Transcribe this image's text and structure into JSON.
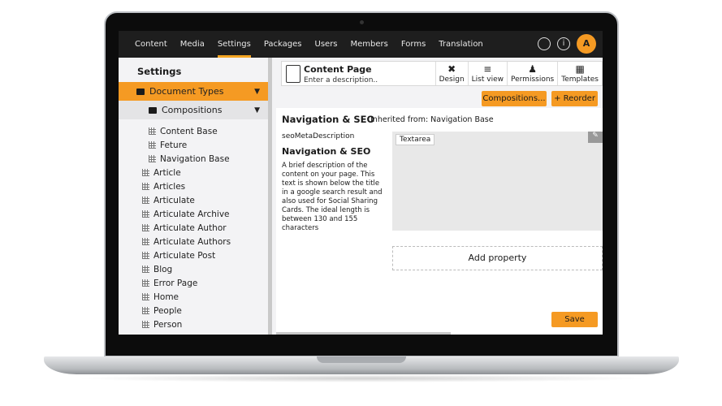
{
  "topnav": {
    "items": [
      "Content",
      "Media",
      "Settings",
      "Packages",
      "Users",
      "Members",
      "Forms",
      "Translation"
    ],
    "active": "Settings",
    "avatar": "A"
  },
  "sidebar": {
    "title": "Settings",
    "document_types": "Document Types",
    "compositions": "Compositions",
    "composition_items": [
      "Content Base",
      "Feture",
      "Navigation Base"
    ],
    "items": [
      "Article",
      "Articles",
      "Articulate",
      "Articulate Archive",
      "Articulate Author",
      "Articulate Authors",
      "Articulate Post",
      "Blog",
      "Error Page",
      "Home",
      "People",
      "Person"
    ]
  },
  "header": {
    "name": "Content Page",
    "description": "Enter a description..",
    "tools": [
      "Design",
      "List view",
      "Permissions",
      "Templates"
    ]
  },
  "actions": {
    "compositions": "Compositions...",
    "reorder": "+ Reorder",
    "save": "Save"
  },
  "group": {
    "title": "Navigation & SEO",
    "inherited": "Inherited from: Navigation Base"
  },
  "property": {
    "alias": "seoMetaDescription",
    "name": "Navigation & SEO",
    "description": "A brief description of the content on your page. This text is shown below the title in a google search result and also used for Social Sharing Cards. The ideal length is between 130 and 155 characters",
    "editor": "Textarea"
  },
  "add_property": "Add property",
  "colors": {
    "accent": "#f59a23",
    "topbar": "#1e1e1e"
  }
}
